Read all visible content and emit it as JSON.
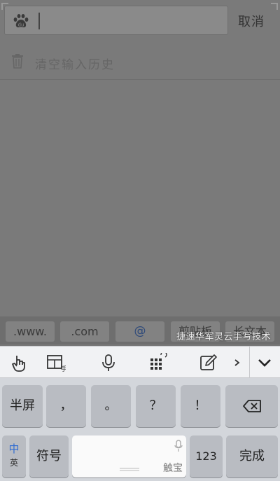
{
  "search": {
    "cancel_label": "取消"
  },
  "history": {
    "clear_label": "清空输入历史"
  },
  "quick_keys": [
    ".www.",
    ".com",
    "@",
    "剪贴板",
    "长文本"
  ],
  "watermark": "捷速华军灵云手写技术",
  "keyboard": {
    "row1": [
      "半屏",
      "，",
      "。",
      "？",
      "！"
    ],
    "lang_top": "中",
    "lang_bottom": "英",
    "symbols_label": "符号",
    "space_hint": "触宝",
    "numbers_label": "123",
    "done_label": "完成"
  },
  "toolbar_icons": [
    "hand-pointer-icon",
    "handwriting-layout-icon",
    "microphone-icon",
    "keypad-grid-icon",
    "edit-icon",
    "chevron-right-icon",
    "collapse-keyboard-icon"
  ]
}
